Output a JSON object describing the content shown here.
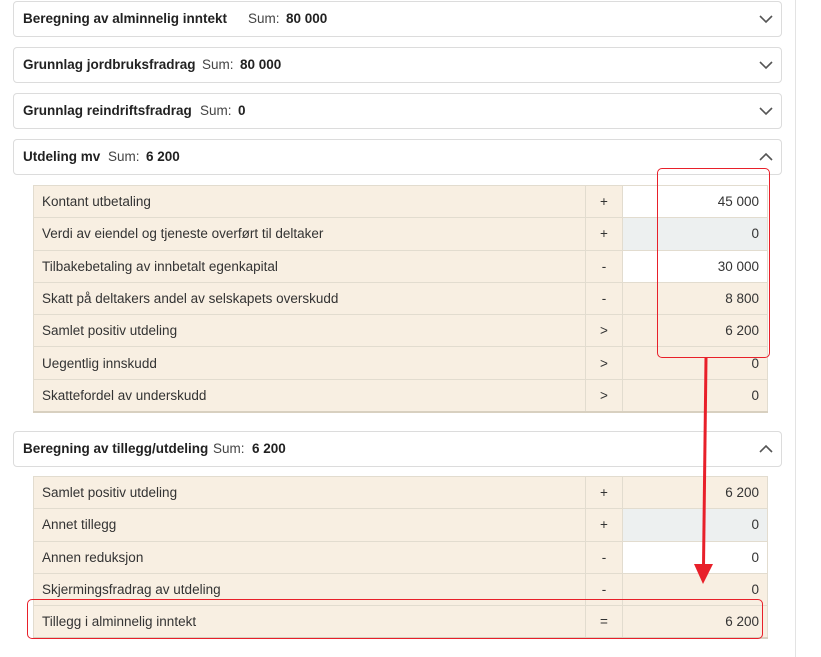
{
  "panels": [
    {
      "title": "Beregning av alminnelig inntekt",
      "sum_label": "Sum:",
      "sum_value": "80 000",
      "chevron": "chevron-down-icon"
    },
    {
      "title": "Grunnlag jordbruksfradrag",
      "sum_label": "Sum:",
      "sum_value": "80 000",
      "chevron": "chevron-down-icon"
    },
    {
      "title": "Grunnlag reindriftsfradrag",
      "sum_label": "Sum:",
      "sum_value": "0",
      "chevron": "chevron-down-icon"
    },
    {
      "title": "Utdeling mv",
      "sum_label": "Sum:",
      "sum_value": "6 200",
      "chevron": "chevron-up-icon"
    },
    {
      "title": "Beregning av tillegg/utdeling",
      "sum_label": "Sum:",
      "sum_value": "6 200",
      "chevron": "chevron-up-icon"
    }
  ],
  "utdeling_rows": [
    {
      "label": "Kontant utbetaling",
      "op": "+",
      "value": "45 000"
    },
    {
      "label": "Verdi av eiendel og tjeneste overført til deltaker",
      "op": "+",
      "value": "0"
    },
    {
      "label": "Tilbakebetaling av innbetalt egenkapital",
      "op": "-",
      "value": "30 000"
    },
    {
      "label": "Skatt på deltakers andel av selskapets overskudd",
      "op": "-",
      "value": "8 800"
    },
    {
      "label": "Samlet positiv utdeling",
      "op": ">",
      "value": "6 200"
    },
    {
      "label": "Uegentlig innskudd",
      "op": ">",
      "value": "0"
    },
    {
      "label": "Skattefordel av underskudd",
      "op": ">",
      "value": "0"
    }
  ],
  "tillegg_rows": [
    {
      "label": "Samlet positiv utdeling",
      "op": "+",
      "value": "6 200"
    },
    {
      "label": "Annet tillegg",
      "op": "+",
      "value": "0"
    },
    {
      "label": "Annen reduksjon",
      "op": "-",
      "value": "0"
    },
    {
      "label": "Skjermingsfradrag av utdeling",
      "op": "-",
      "value": "0"
    },
    {
      "label": "Tillegg i alminnelig inntekt",
      "op": "=",
      "value": "6 200"
    }
  ],
  "colors": {
    "highlight": "#e8202a",
    "row_background": "#f8efe2",
    "input_background": "#ffffff",
    "disabled_input_background": "#edf0f0"
  }
}
